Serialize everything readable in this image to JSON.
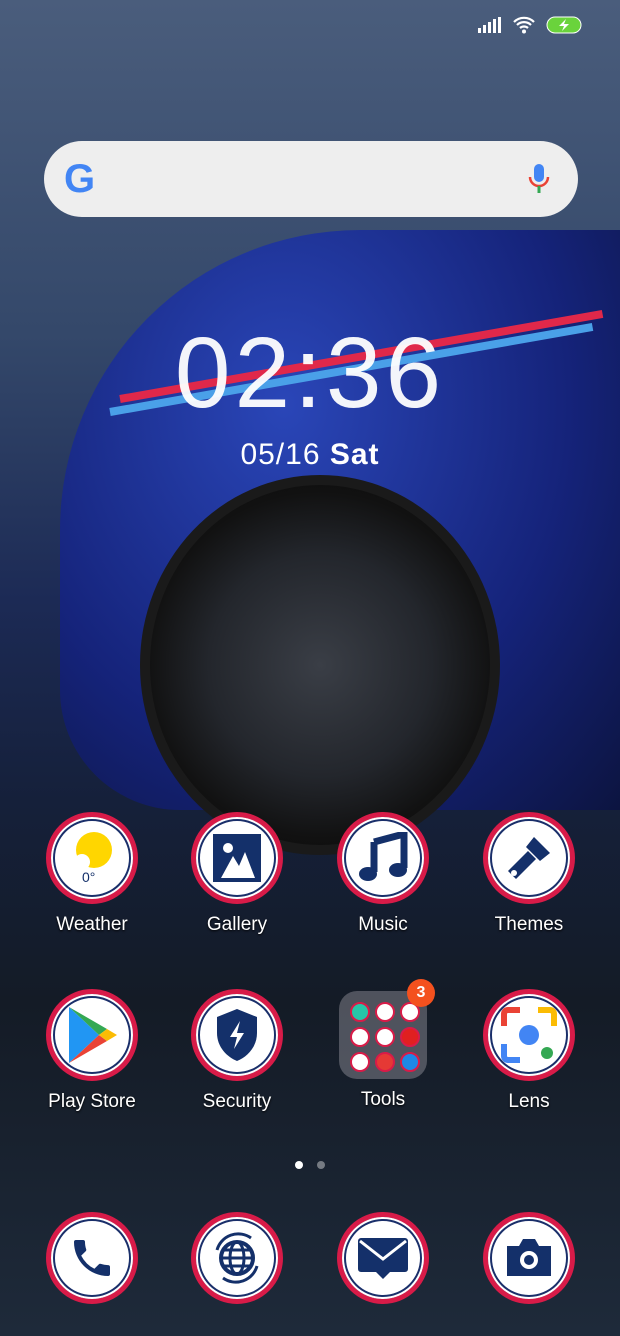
{
  "status": {
    "signal": "signal-icon",
    "wifi": "wifi-icon",
    "battery": "battery-charging-icon",
    "battery_color": "#6ad33c"
  },
  "search": {
    "logo": "G",
    "mic": "mic-icon"
  },
  "clock": {
    "time": "02:36",
    "date": "05/16",
    "day": "Sat"
  },
  "apps": [
    {
      "label": "Weather",
      "icon": "weather-icon",
      "temp": "0°"
    },
    {
      "label": "Gallery",
      "icon": "gallery-icon"
    },
    {
      "label": "Music",
      "icon": "music-icon"
    },
    {
      "label": "Themes",
      "icon": "brush-icon"
    },
    {
      "label": "Play Store",
      "icon": "play-store-icon"
    },
    {
      "label": "Security",
      "icon": "security-icon"
    },
    {
      "label": "Tools",
      "icon": "folder-icon",
      "badge": "3"
    },
    {
      "label": "Lens",
      "icon": "lens-icon"
    }
  ],
  "dock": [
    {
      "icon": "phone-icon"
    },
    {
      "icon": "browser-icon"
    },
    {
      "icon": "messages-icon"
    },
    {
      "icon": "camera-icon"
    }
  ],
  "pages": {
    "current": 1,
    "total": 2
  },
  "colors": {
    "ring": "#d81b48",
    "navy": "#14306a"
  }
}
